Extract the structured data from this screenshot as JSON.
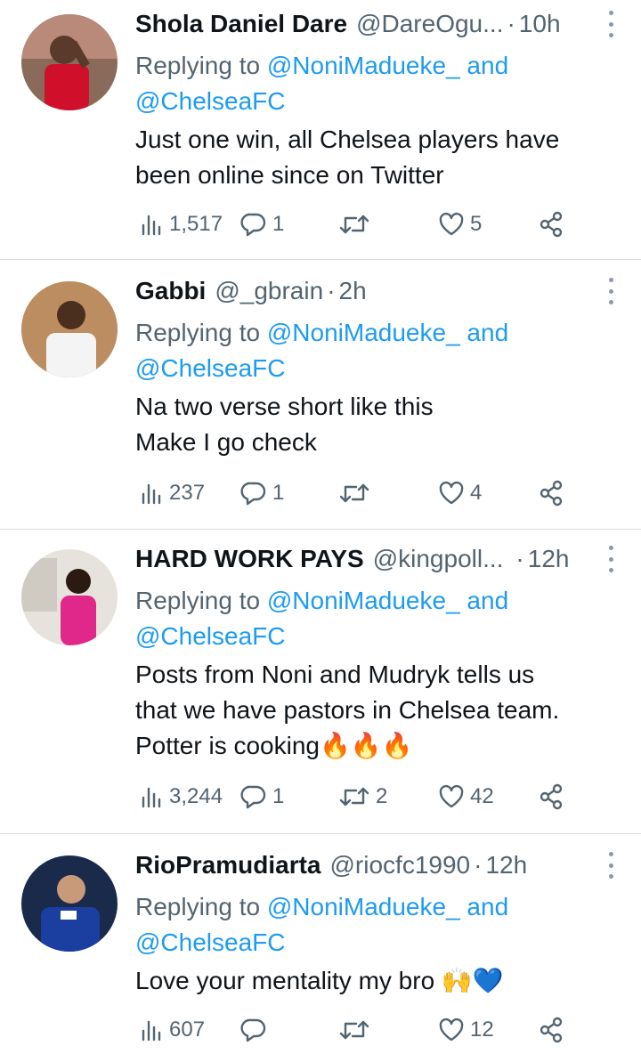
{
  "tweets": [
    {
      "name": "Shola Daniel Dare",
      "handle": "@DareOgu...",
      "time": "10h",
      "reply_prefix": "Replying to",
      "reply_mentions": "@NoniMadueke_ and @ChelseaFC",
      "body_lines": [
        "Just one win, all Chelsea players have",
        "been online since on Twitter"
      ],
      "views": "1,517",
      "replies": "1",
      "retweets": "",
      "likes": "5"
    },
    {
      "name": "Gabbi",
      "handle": "@_gbrain",
      "time": "2h",
      "reply_prefix": "Replying to",
      "reply_mentions": "@NoniMadueke_ and @ChelseaFC",
      "body_lines": [
        "Na two verse short like this",
        "Make I go check"
      ],
      "views": "237",
      "replies": "1",
      "retweets": "",
      "likes": "4"
    },
    {
      "name": "HARD WORK PAYS",
      "handle": "@kingpoll...",
      "time": "12h",
      "reply_prefix": "Replying to",
      "reply_mentions": "@NoniMadueke_ and @ChelseaFC",
      "body_lines": [
        "Posts from  Noni and Mudryk tells us",
        "that we have pastors in Chelsea team.",
        "Potter is cooking🔥🔥🔥"
      ],
      "views": "3,244",
      "replies": "1",
      "retweets": "2",
      "likes": "42"
    },
    {
      "name": "RioPramudiarta",
      "handle": "@riocfc1990",
      "time": "12h",
      "reply_prefix": "Replying to",
      "reply_mentions": "@NoniMadueke_ and @ChelseaFC",
      "body_lines": [
        "Love your mentality my bro 🙌💙"
      ],
      "views": "607",
      "replies": "",
      "retweets": "",
      "likes": "12"
    }
  ],
  "colors": {
    "text": "#0f1419",
    "secondary": "#536471",
    "link": "#1d9bf0",
    "divider": "#d9dde1"
  },
  "icons": [
    "analytics-icon",
    "reply-icon",
    "retweet-icon",
    "like-icon",
    "share-icon",
    "more-icon"
  ]
}
